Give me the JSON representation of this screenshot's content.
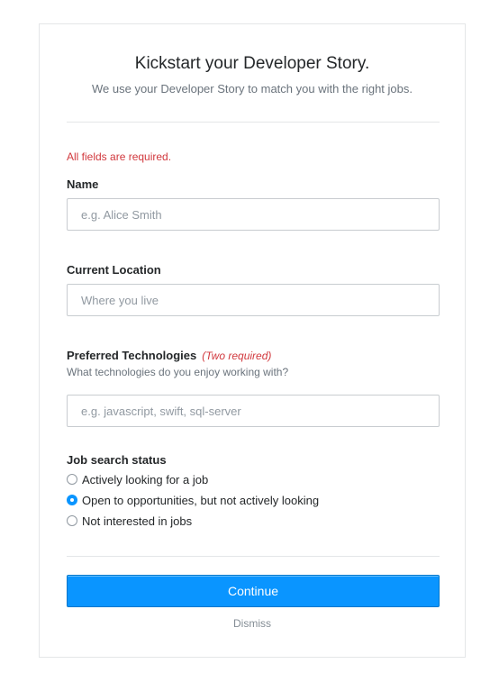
{
  "header": {
    "title": "Kickstart your Developer Story.",
    "subtitle": "We use your Developer Story to match you with the right jobs."
  },
  "form": {
    "required_note": "All fields are required.",
    "name": {
      "label": "Name",
      "placeholder": "e.g. Alice Smith",
      "value": ""
    },
    "location": {
      "label": "Current Location",
      "placeholder": "Where you live",
      "value": ""
    },
    "technologies": {
      "label": "Preferred Technologies",
      "note": "(Two required)",
      "help": "What technologies do you enjoy working with?",
      "placeholder": "e.g. javascript, swift, sql-server",
      "value": ""
    },
    "job_status": {
      "label": "Job search status",
      "options": [
        {
          "label": "Actively looking for a job",
          "checked": false
        },
        {
          "label": "Open to opportunities, but not actively looking",
          "checked": true
        },
        {
          "label": "Not interested in jobs",
          "checked": false
        }
      ]
    }
  },
  "actions": {
    "continue_label": "Continue",
    "dismiss_label": "Dismiss"
  },
  "colors": {
    "accent": "#0a95ff",
    "error": "#d1383d"
  }
}
